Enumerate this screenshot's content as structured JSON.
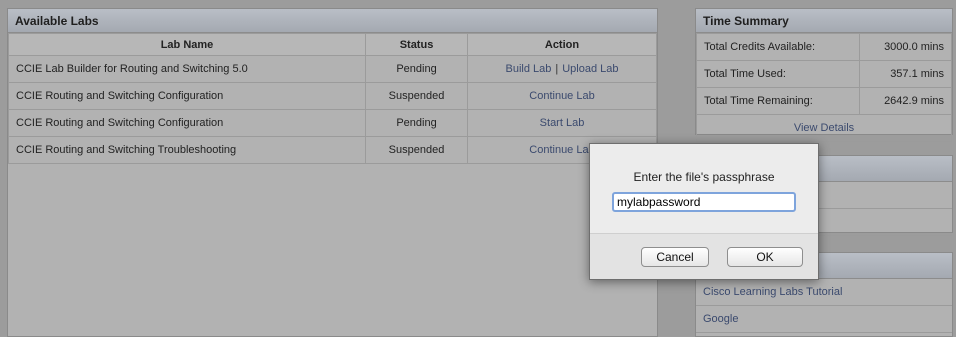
{
  "labs": {
    "title": "Available Labs",
    "headers": [
      "Lab Name",
      "Status",
      "Action"
    ],
    "rows": [
      {
        "name": "CCIE Lab Builder for Routing and Switching 5.0",
        "status": "Pending",
        "actions": [
          "Build Lab",
          "Upload Lab"
        ]
      },
      {
        "name": "CCIE Routing and Switching Configuration",
        "status": "Suspended",
        "actions": [
          "Continue Lab"
        ]
      },
      {
        "name": "CCIE Routing and Switching Configuration",
        "status": "Pending",
        "actions": [
          "Start Lab"
        ]
      },
      {
        "name": "CCIE Routing and Switching Troubleshooting",
        "status": "Suspended",
        "actions": [
          "Continue Lab"
        ]
      }
    ],
    "action_separator": "|"
  },
  "time_summary": {
    "title": "Time Summary",
    "rows": [
      {
        "label": "Total Credits Available:",
        "value": "3000.0 mins"
      },
      {
        "label": "Total Time Used:",
        "value": "357.1 mins"
      },
      {
        "label": "Total Time Remaining:",
        "value": "2642.9 mins"
      }
    ],
    "details_link": "View Details"
  },
  "resources": {
    "links": [
      "Cisco Learning Labs Tutorial",
      "Google"
    ]
  },
  "dialog": {
    "prompt": "Enter the file's passphrase",
    "input_value": "mylabpassword",
    "cancel_label": "Cancel",
    "ok_label": "OK"
  }
}
